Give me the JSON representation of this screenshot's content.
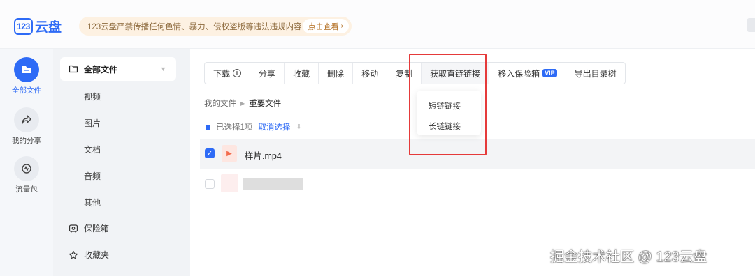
{
  "header": {
    "logo_badge": "123",
    "logo_text": "云盘",
    "notice_text": "123云盘严禁传播任何色情、暴力、侵权盗版等违法违规内容",
    "notice_button": "点击查看"
  },
  "rail": {
    "items": [
      {
        "label": "全部文件",
        "icon": "folder-icon",
        "active": true
      },
      {
        "label": "我的分享",
        "icon": "share-icon",
        "active": false
      },
      {
        "label": "流量包",
        "icon": "traffic-icon",
        "active": false
      }
    ]
  },
  "sidebar": {
    "main_label": "全部文件",
    "sub_items": [
      "视频",
      "图片",
      "文档",
      "音频",
      "其他"
    ],
    "safe_label": "保险箱",
    "favorites_label": "收藏夹"
  },
  "toolbar": {
    "download": "下载",
    "share": "分享",
    "favorite": "收藏",
    "delete": "删除",
    "move": "移动",
    "copy": "复制",
    "get_direct_link": "获取直链链接",
    "move_to_safe": "移入保险箱",
    "vip_badge": "VIP",
    "export_tree": "导出目录树"
  },
  "breadcrumb": {
    "root": "我的文件",
    "current": "重要文件"
  },
  "selection": {
    "text": "已选择1项",
    "cancel": "取消选择"
  },
  "files": [
    {
      "name": "样片.mp4",
      "selected": true
    }
  ],
  "dropdown": {
    "short_link": "短链链接",
    "long_link": "长链链接"
  },
  "watermark": "掘金技术社区 @ 123云盘",
  "colors": {
    "accent": "#2e6bf6",
    "highlight": "#e53a3a",
    "notice_bg": "#fdf1e2"
  }
}
